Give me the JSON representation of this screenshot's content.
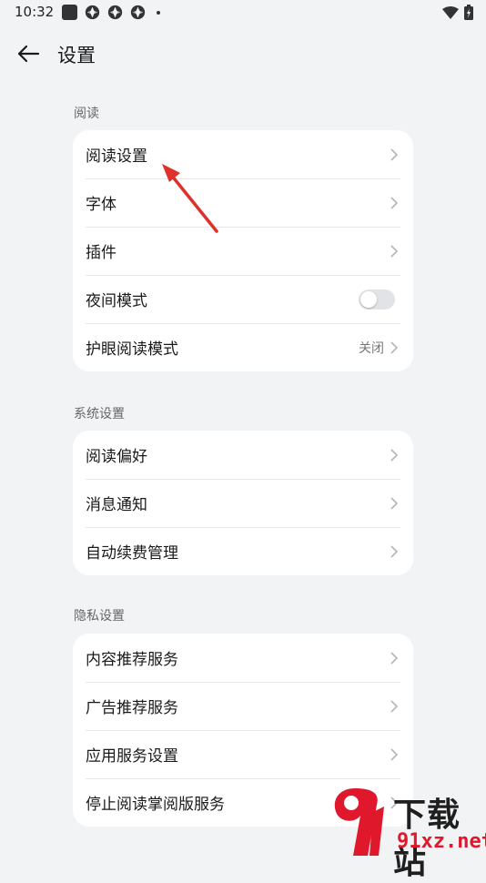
{
  "status_bar": {
    "time": "10:32"
  },
  "header": {
    "title": "设置"
  },
  "sections": [
    {
      "label": "阅读",
      "items": [
        {
          "label": "阅读设置",
          "control": "chevron"
        },
        {
          "label": "字体",
          "control": "chevron"
        },
        {
          "label": "插件",
          "control": "chevron"
        },
        {
          "label": "夜间模式",
          "control": "toggle",
          "toggle_on": false
        },
        {
          "label": "护眼阅读模式",
          "value": "关闭",
          "control": "chevron"
        }
      ]
    },
    {
      "label": "系统设置",
      "items": [
        {
          "label": "阅读偏好",
          "control": "chevron"
        },
        {
          "label": "消息通知",
          "control": "chevron"
        },
        {
          "label": "自动续费管理",
          "control": "chevron"
        }
      ]
    },
    {
      "label": "隐私设置",
      "items": [
        {
          "label": "内容推荐服务",
          "control": "chevron"
        },
        {
          "label": "广告推荐服务",
          "control": "chevron"
        },
        {
          "label": "应用服务设置",
          "control": "chevron"
        },
        {
          "label": "停止阅读掌阅版服务",
          "control": "chevron"
        }
      ]
    }
  ],
  "watermark": {
    "text": "下载站",
    "url": "91xz.net"
  },
  "colors": {
    "background": "#f1f3f5",
    "card": "#ffffff",
    "annotation_arrow": "#e0302c",
    "watermark_red": "#e0182b"
  },
  "icons": {
    "back": "arrow-left-icon",
    "chevron": "chevron-right-icon",
    "annotation": "red-arrow-pointer"
  }
}
